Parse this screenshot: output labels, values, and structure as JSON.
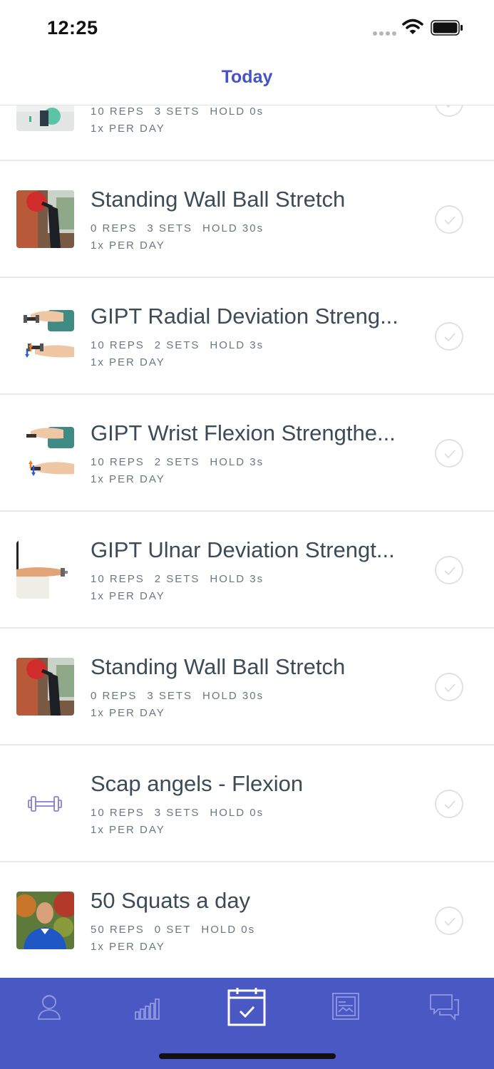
{
  "status": {
    "time": "12:25"
  },
  "nav": {
    "title": "Today"
  },
  "exercises": [
    {
      "title": "",
      "reps": "10 REPS",
      "sets": "3 SETS",
      "hold": "HOLD 0s",
      "freq": "1x PER DAY",
      "thumb": "ball-stretch-thumb"
    },
    {
      "title": "Standing Wall Ball Stretch",
      "reps": "0 REPS",
      "sets": "3 SETS",
      "hold": "HOLD 30s",
      "freq": "1x PER DAY",
      "thumb": "wall-ball-photo"
    },
    {
      "title": "GIPT Radial Deviation Streng...",
      "reps": "10 REPS",
      "sets": "2 SETS",
      "hold": "HOLD 3s",
      "freq": "1x PER DAY",
      "thumb": "dumbbell-wrist-illustration"
    },
    {
      "title": "GIPT Wrist Flexion Strengthe...",
      "reps": "10 REPS",
      "sets": "2 SETS",
      "hold": "HOLD 3s",
      "freq": "1x PER DAY",
      "thumb": "dumbbell-wrist-illustration"
    },
    {
      "title": "GIPT Ulnar Deviation Strengt...",
      "reps": "10 REPS",
      "sets": "2 SETS",
      "hold": "HOLD 3s",
      "freq": "1x PER DAY",
      "thumb": "arm-dumbbell-photo"
    },
    {
      "title": "Standing Wall Ball Stretch",
      "reps": "0 REPS",
      "sets": "3 SETS",
      "hold": "HOLD 30s",
      "freq": "1x PER DAY",
      "thumb": "wall-ball-photo"
    },
    {
      "title": "Scap angels - Flexion",
      "reps": "10 REPS",
      "sets": "3 SETS",
      "hold": "HOLD 0s",
      "freq": "1x PER DAY",
      "thumb": "dumbbell-icon"
    },
    {
      "title": "50 Squats a day",
      "reps": "50 REPS",
      "sets": "0 SET",
      "hold": "HOLD 0s",
      "freq": "1x PER DAY",
      "thumb": "person-photo"
    }
  ],
  "tabs": [
    {
      "name": "profile-icon"
    },
    {
      "name": "chart-icon"
    },
    {
      "name": "calendar-check-icon",
      "active": true
    },
    {
      "name": "library-icon"
    },
    {
      "name": "messages-icon"
    }
  ],
  "colors": {
    "accent": "#4653c6",
    "tab_bar": "#4a58c4",
    "text": "#3d4a57",
    "meta": "#6b7681"
  }
}
